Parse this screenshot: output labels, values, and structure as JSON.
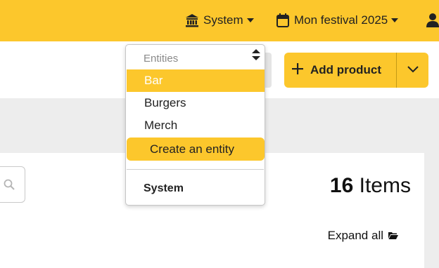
{
  "topbar": {
    "system_label": "System",
    "festival_label": "Mon festival 2025",
    "icons": [
      "bank-icon",
      "calendar-icon",
      "user-icon"
    ]
  },
  "toolbar": {
    "add_product_label": "Add product"
  },
  "dropdown": {
    "header": "Entities",
    "options": [
      "Bar",
      "Burgers",
      "Merch"
    ],
    "selected": "Bar",
    "create_label": "Create an entity",
    "group_label": "System"
  },
  "list": {
    "items_count": "16",
    "items_label": "Items",
    "expand_all_label": "Expand all"
  },
  "colors": {
    "accent": "#fcc72c",
    "background": "#ededed"
  }
}
